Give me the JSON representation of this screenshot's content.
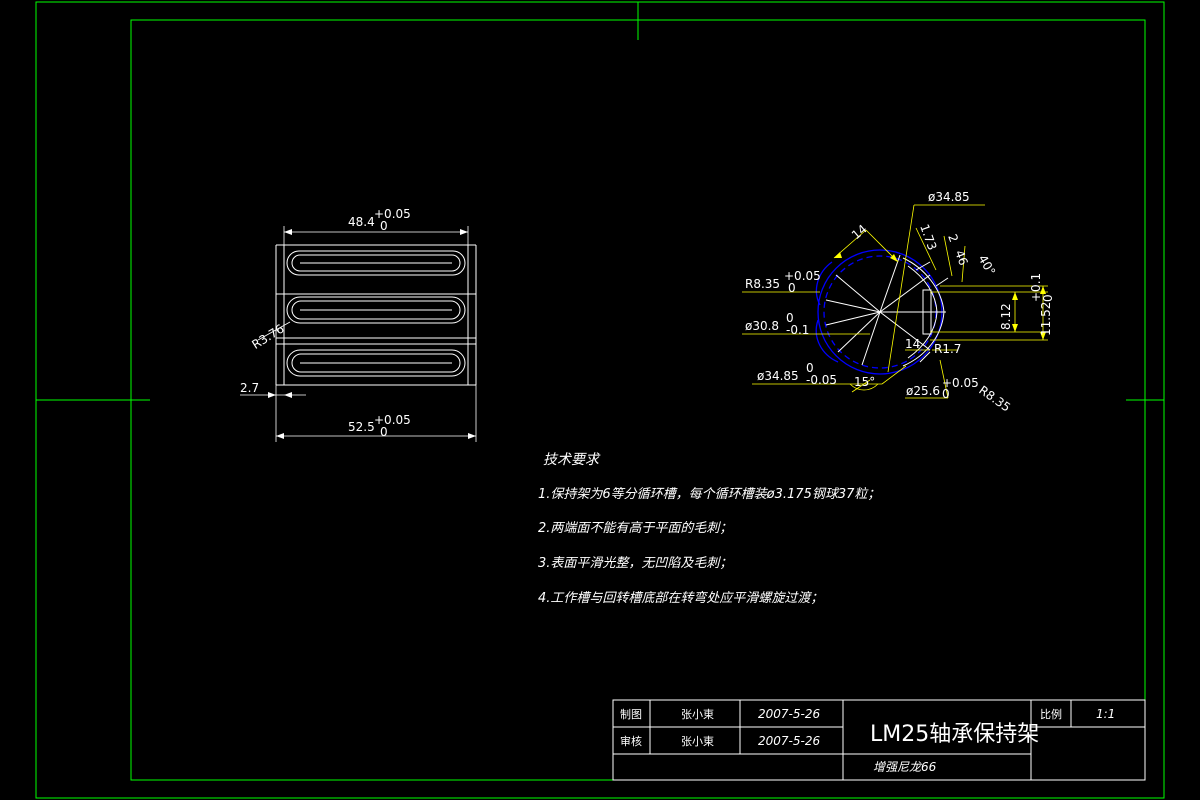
{
  "colors": {
    "background": "#000000",
    "frame": "#00ff00",
    "geometry": "#ffffff",
    "dimension": "#ffff00",
    "hidden": "#0000ff"
  },
  "front_view": {
    "top_dim": "48.4",
    "top_tol_upper": "+0.05",
    "top_tol_lower": "0",
    "bottom_dim": "52.5",
    "bottom_tol_upper": "+0.05",
    "bottom_tol_lower": "0",
    "left_dim": "2.7",
    "radius_label": "R3.76"
  },
  "side_view": {
    "d_top": "ø34.85",
    "r_left": "R8.35",
    "r_left_tol_upper": "+0.05",
    "r_left_tol_lower": "0",
    "d_inner": "ø30.8",
    "d_inner_tol_upper": "0",
    "d_inner_tol_lower": "-0.1",
    "d_bottom": "ø34.85",
    "d_bottom_tol_upper": "0",
    "d_bottom_tol_lower": "-0.05",
    "angle_15": "15°",
    "d_small": "ø25.6",
    "d_small_tol_upper": "+0.05",
    "d_small_tol_lower": "0",
    "r_bottom_right": "R8.35",
    "dim_14_top": "14",
    "dim_14_bottom": "14",
    "dim_173": "1.73",
    "dim_2": "2",
    "dim_46": "46",
    "angle_40": "40°",
    "dim_812": "8.12",
    "dim_1152": "11.52",
    "dim_1152_tol_upper": "+0.1",
    "dim_1152_tol_lower": "0",
    "r17": "R1.7"
  },
  "tech": {
    "title": "技术要求",
    "items": [
      "1.保持架为6等分循环槽，每个循环槽装ø3.175钢球37粒；",
      "2.两端面不能有高于平面的毛刺；",
      "3.表面平滑光整，无凹陷及毛刺；",
      "4.工作槽与回转槽底部在转弯处应平滑螺旋过渡；"
    ]
  },
  "title_block": {
    "row1_label": "制图",
    "row1_name": "张小東",
    "row1_date": "2007-5-26",
    "row2_label": "审核",
    "row2_name": "张小東",
    "row2_date": "2007-5-26",
    "part_name": "LM25轴承保持架",
    "scale_label": "比例",
    "scale_value": "1:1",
    "org": "增强尼龙66"
  }
}
